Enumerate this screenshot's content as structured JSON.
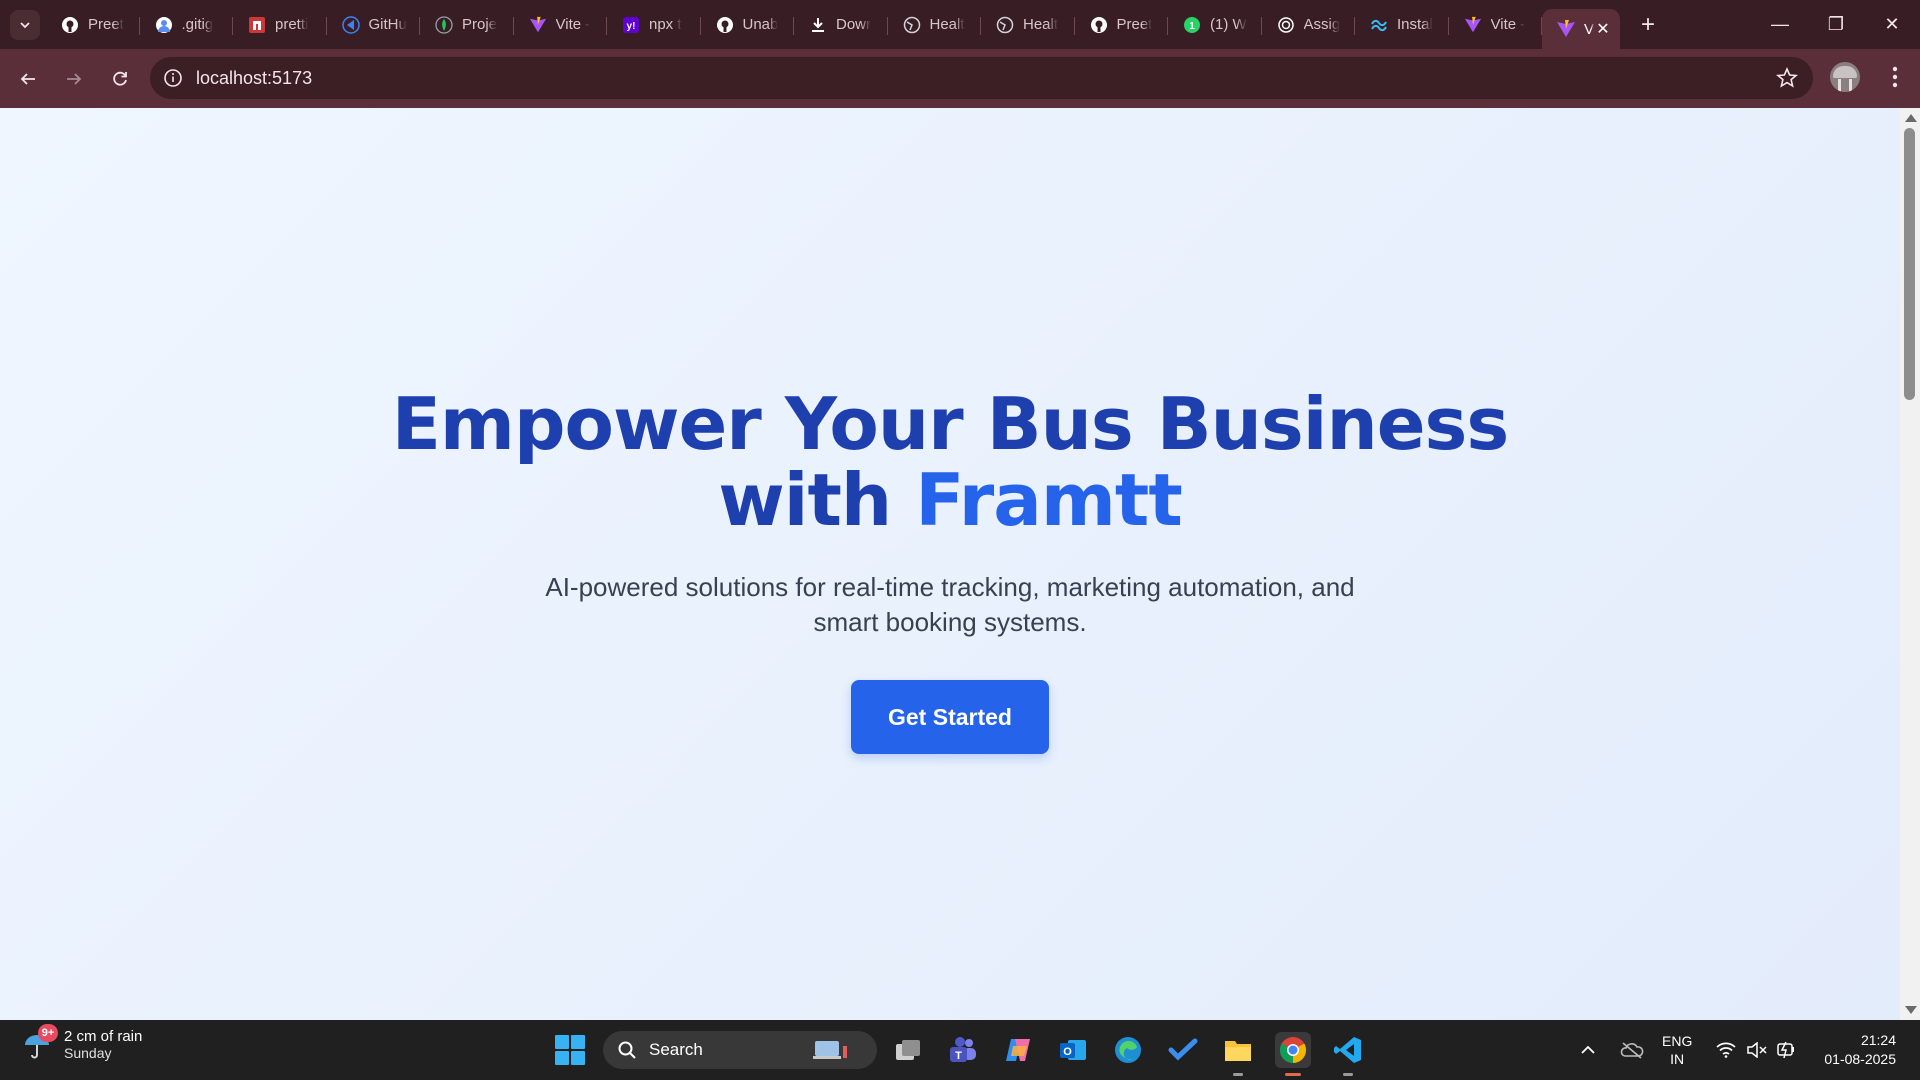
{
  "browser": {
    "tabs": [
      {
        "label": "Preet",
        "icon": "github-icon",
        "color": "#ffffff"
      },
      {
        "label": ".gitig",
        "icon": "avatar-icon",
        "color": "#5b8def"
      },
      {
        "label": "pretti",
        "icon": "npm-icon",
        "color": "#cb3837"
      },
      {
        "label": "GitHu",
        "icon": "vscode-icon",
        "color": "#3b82f6"
      },
      {
        "label": "Proje",
        "icon": "mongodb-icon",
        "color": "#22c55e"
      },
      {
        "label": "Vite -",
        "icon": "vite-icon",
        "color": "#a855f7"
      },
      {
        "label": "npx t",
        "icon": "yahoo-icon",
        "color": "#6001d2"
      },
      {
        "label": "Unab",
        "icon": "github-icon",
        "color": "#ffffff"
      },
      {
        "label": "Dowr",
        "icon": "download-icon",
        "color": "#ffffff"
      },
      {
        "label": "Healt",
        "icon": "globe-icon",
        "color": "#d1d5db"
      },
      {
        "label": "Healt",
        "icon": "globe-icon",
        "color": "#d1d5db"
      },
      {
        "label": "Preet",
        "icon": "github-icon",
        "color": "#ffffff"
      },
      {
        "label": "(1) W",
        "icon": "whatsapp-icon",
        "color": "#25d366"
      },
      {
        "label": "Assig",
        "icon": "openai-icon",
        "color": "#ffffff"
      },
      {
        "label": "Instal",
        "icon": "tailwind-icon",
        "color": "#38bdf8"
      },
      {
        "label": "Vite -",
        "icon": "vite-icon",
        "color": "#a855f7"
      }
    ],
    "active_tab": {
      "label": "V",
      "icon": "vite-icon"
    },
    "url": "localhost:5173"
  },
  "page": {
    "headline_line1": "Empower Your Bus Business",
    "headline_prefix": "with",
    "brand": "Framtt",
    "subtitle": "AI-powered solutions for real-time tracking, marketing automation, and smart booking systems.",
    "cta_label": "Get Started"
  },
  "taskbar": {
    "weather_badge": "9+",
    "weather_line1": "2 cm of rain",
    "weather_line2": "Sunday",
    "search_label": "Search",
    "apps": [
      "task-view",
      "teams",
      "copilot",
      "outlook",
      "edge",
      "todo",
      "file-explorer",
      "chrome",
      "vscode"
    ],
    "lang_line1": "ENG",
    "lang_line2": "IN",
    "time": "21:24",
    "date": "01-08-2025"
  },
  "colors": {
    "headline": "#1e40af",
    "brand": "#2563eb",
    "cta": "#2563eb",
    "browser_frame": "#5a2f3a"
  }
}
